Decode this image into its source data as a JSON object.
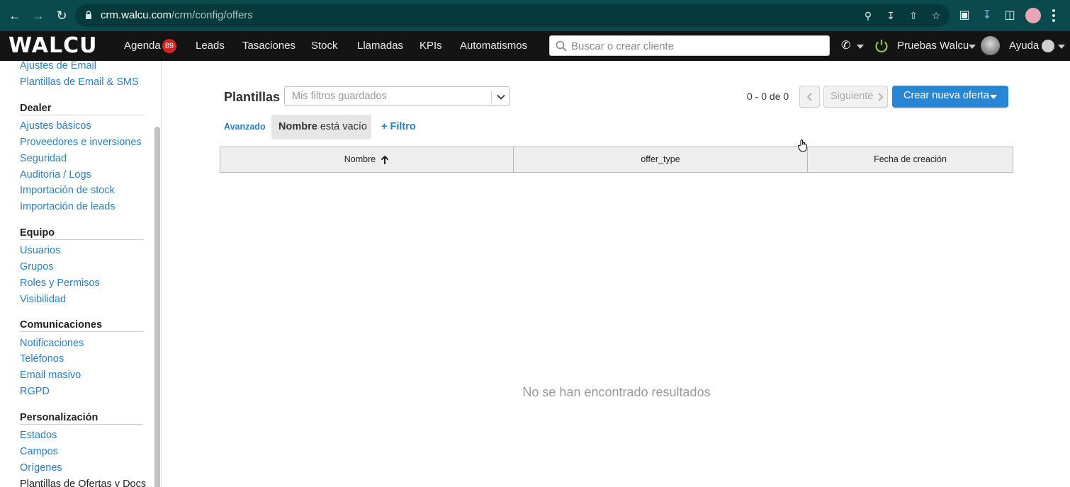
{
  "browser": {
    "url_host": "crm.walcu.com",
    "url_path": "/crm/config/offers"
  },
  "app_nav": {
    "logo": "WALCU",
    "menu": [
      {
        "label": "Agenda",
        "badge": "89"
      },
      {
        "label": "Leads"
      },
      {
        "label": "Tasaciones"
      },
      {
        "label": "Stock"
      },
      {
        "label": "Llamadas"
      },
      {
        "label": "KPIs"
      },
      {
        "label": "Automatismos"
      }
    ],
    "search_placeholder": "Buscar o crear cliente",
    "user_name": "Pruebas Walcu",
    "help_label": "Ayuda",
    "status_color": "#8bc34a"
  },
  "sidebar": {
    "top_links": [
      "Ajustes de Email",
      "Plantillas de Email & SMS"
    ],
    "sections": [
      {
        "title": "Dealer",
        "items": [
          "Ajustes básicos",
          "Proveedores e inversiones",
          "Seguridad",
          "Auditoria / Logs",
          "Importación de stock",
          "Importación de leads"
        ]
      },
      {
        "title": "Equipo",
        "items": [
          "Usuarios",
          "Grupos",
          "Roles y Permisos",
          "Visibilidad"
        ]
      },
      {
        "title": "Comunicaciones",
        "items": [
          "Notificaciones",
          "Teléfonos",
          "Email masivo",
          "RGPD"
        ]
      },
      {
        "title": "Personalización",
        "items": [
          "Estados",
          "Campos",
          "Orígenes",
          "Plantillas de Ofertas y Docs"
        ]
      }
    ],
    "active_item": "Plantillas de Ofertas y Docs"
  },
  "main": {
    "title": "Plantillas",
    "saved_filters_placeholder": "Mis filtros guardados",
    "pagination": {
      "count": "0 - 0 de 0",
      "next_label": "Siguiente"
    },
    "create_button": "Crear nueva oferta",
    "advanced_label": "Avanzado",
    "filter_chip": {
      "field": "Nombre",
      "condition": "está vacío"
    },
    "add_filter_label": "+ Filtro",
    "columns": [
      "Nombre",
      "offer_type",
      "Fecha de creación"
    ],
    "sort_column": "Nombre",
    "sort_direction": "asc",
    "empty_message": "No se han encontrado resultados"
  },
  "colors": {
    "browser_bar": "#0b4a4c",
    "app_nav": "#141414",
    "link": "#2a7fc1",
    "primary_button": "#2787d6",
    "badge": "#d32424"
  }
}
